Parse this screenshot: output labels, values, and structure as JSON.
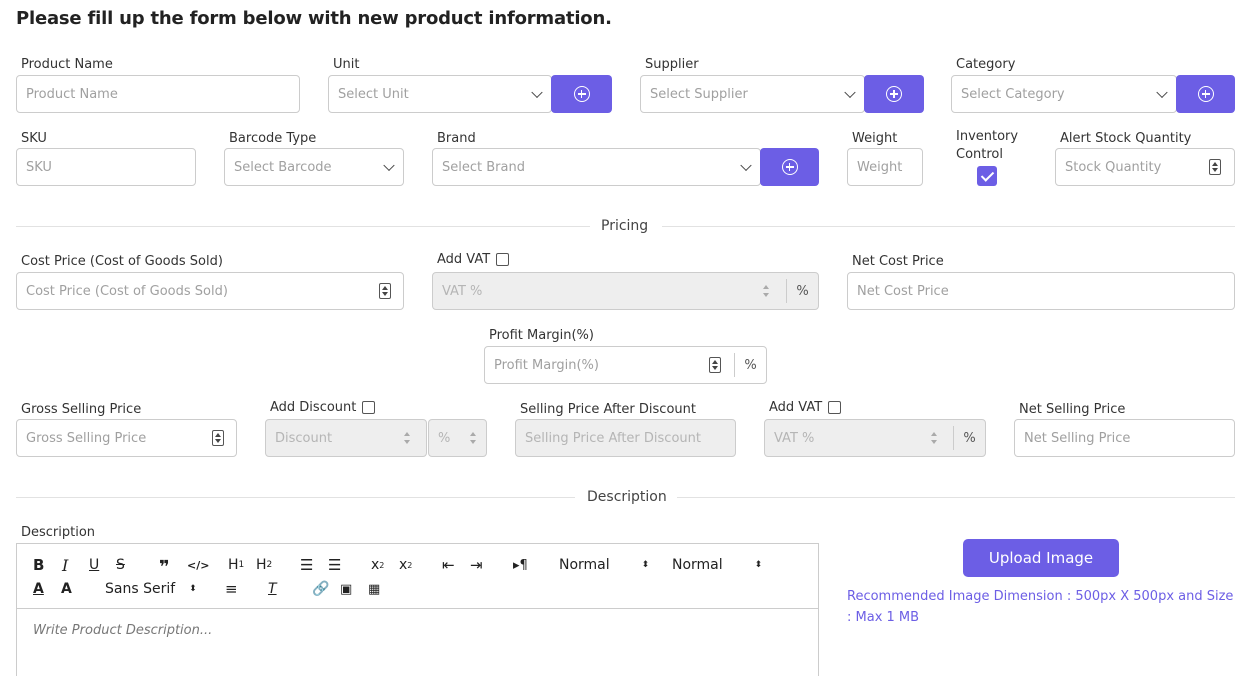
{
  "heading": "Please fill up the form below with new product information.",
  "row1": {
    "product_name": {
      "label": "Product Name",
      "placeholder": "Product Name"
    },
    "unit": {
      "label": "Unit",
      "placeholder": "Select Unit"
    },
    "supplier": {
      "label": "Supplier",
      "placeholder": "Select Supplier"
    },
    "category": {
      "label": "Category",
      "placeholder": "Select Category"
    }
  },
  "row2": {
    "sku": {
      "label": "SKU",
      "placeholder": "SKU"
    },
    "barcode": {
      "label": "Barcode Type",
      "placeholder": "Select Barcode"
    },
    "brand": {
      "label": "Brand",
      "placeholder": "Select Brand"
    },
    "weight": {
      "label": "Weight",
      "placeholder": "Weight"
    },
    "inventory": {
      "label_line1": "Inventory",
      "label_line2": "Control",
      "checked": true
    },
    "alert_stock": {
      "label": "Alert Stock Quantity",
      "placeholder": "Stock Quantity"
    }
  },
  "pricing": {
    "section_title": "Pricing",
    "cost_price": {
      "label": "Cost Price (Cost of Goods Sold)",
      "placeholder": "Cost Price (Cost of Goods Sold)"
    },
    "add_vat": {
      "label": "Add VAT",
      "placeholder": "VAT %",
      "unit": "%"
    },
    "net_cost": {
      "label": "Net Cost Price",
      "placeholder": "Net Cost Price"
    },
    "profit_margin": {
      "label": "Profit Margin(%)",
      "placeholder": "Profit Margin(%)",
      "unit": "%"
    },
    "gross_selling": {
      "label": "Gross Selling Price",
      "placeholder": "Gross Selling Price"
    },
    "add_discount": {
      "label": "Add Discount",
      "placeholder": "Discount",
      "unit": "%"
    },
    "after_discount": {
      "label": "Selling Price After Discount",
      "placeholder": "Selling Price After Discount"
    },
    "add_vat2": {
      "label": "Add VAT",
      "placeholder": "VAT %",
      "unit": "%"
    },
    "net_selling": {
      "label": "Net Selling Price",
      "placeholder": "Net Selling Price"
    }
  },
  "description": {
    "section_title": "Description",
    "label": "Description",
    "placeholder": "Write Product Description...",
    "toolbar": {
      "size1": "Normal",
      "size2": "Normal",
      "font": "Sans Serif"
    }
  },
  "upload": {
    "button": "Upload Image",
    "hint": "Recommended Image Dimension : 500px X 500px and Size : Max 1 MB"
  },
  "colors": {
    "accent": "#6c5ee5",
    "disabled_bg": "#eeeeee",
    "border": "#cccccc"
  }
}
